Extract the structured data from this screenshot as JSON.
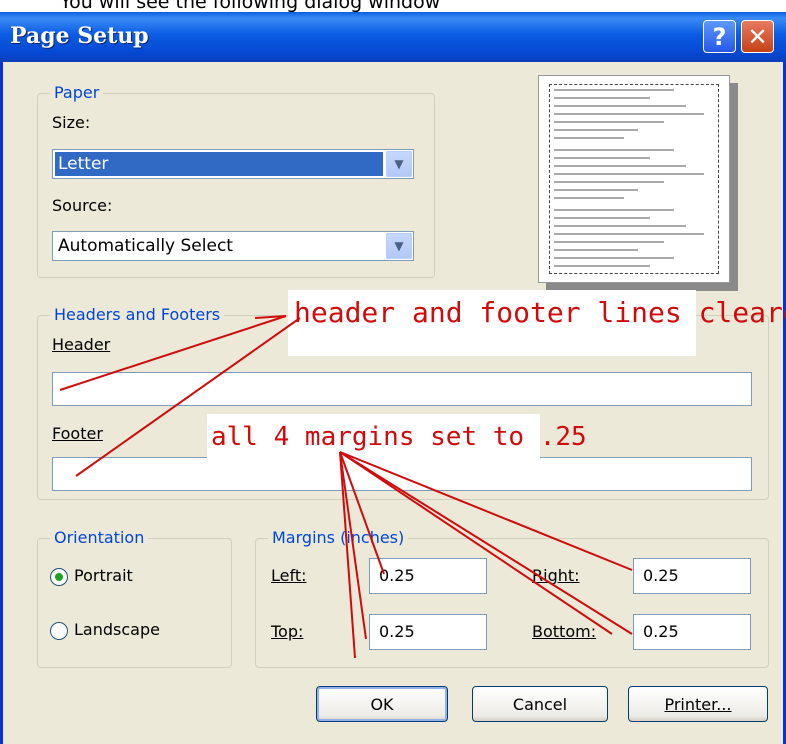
{
  "caption": "You will see the following dialog window",
  "window": {
    "title": "Page Setup",
    "help_glyph": "?",
    "close_glyph": "✕"
  },
  "paper": {
    "legend": "Paper",
    "size_label": "Size:",
    "size_value": "Letter",
    "source_label": "Source:",
    "source_value": "Automatically Select"
  },
  "headers_footers": {
    "legend": "Headers and Footers",
    "header_label": "Header",
    "header_value": "",
    "footer_label": "Footer",
    "footer_value": ""
  },
  "orientation": {
    "legend": "Orientation",
    "portrait_label": "Portrait",
    "landscape_label": "Landscape",
    "selected": "Portrait"
  },
  "margins": {
    "legend": "Margins (inches)",
    "left_label": "Left:",
    "left_value": "0.25",
    "right_label": "Right:",
    "right_value": "0.25",
    "top_label": "Top:",
    "top_value": "0.25",
    "bottom_label": "Bottom:",
    "bottom_value": "0.25"
  },
  "buttons": {
    "ok": "OK",
    "cancel": "Cancel",
    "printer": "Printer..."
  },
  "annotations": {
    "headers_note": "header and footer lines cleared",
    "margins_note": "all 4 margins set to .25",
    "color": "#d10b0b"
  },
  "colors": {
    "titlebar": "#0b5ce4",
    "dialog_bg": "#ece9d8",
    "legend_text": "#0046d5",
    "selection": "#316ac5"
  }
}
